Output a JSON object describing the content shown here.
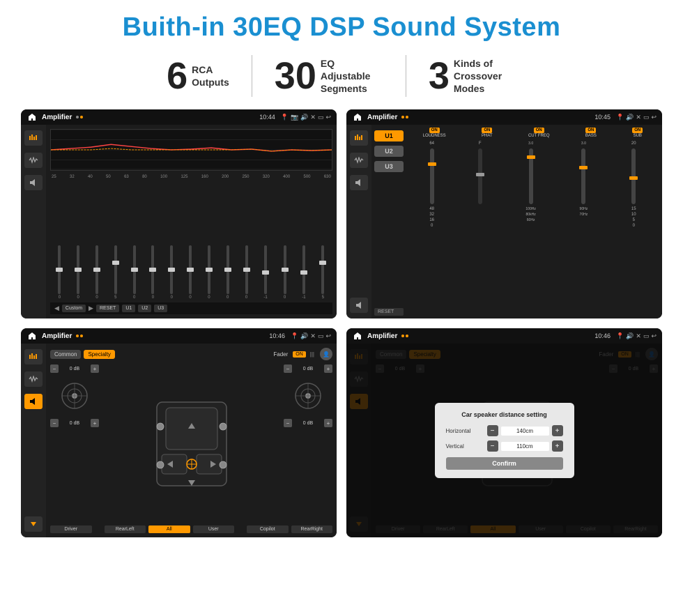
{
  "page": {
    "title": "Buith-in 30EQ DSP Sound System",
    "stats": [
      {
        "number": "6",
        "label": "RCA\nOutputs"
      },
      {
        "number": "30",
        "label": "EQ Adjustable\nSegments"
      },
      {
        "number": "3",
        "label": "Kinds of\nCrossover Modes"
      }
    ],
    "screens": [
      {
        "id": "eq-screen",
        "app": "Amplifier",
        "time": "10:44",
        "type": "eq"
      },
      {
        "id": "crossover-screen",
        "app": "Amplifier",
        "time": "10:45",
        "type": "crossover"
      },
      {
        "id": "fader-screen",
        "app": "Amplifier",
        "time": "10:46",
        "type": "fader"
      },
      {
        "id": "dialog-screen",
        "app": "Amplifier",
        "time": "10:46",
        "type": "dialog"
      }
    ],
    "eq": {
      "frequencies": [
        "25",
        "32",
        "40",
        "50",
        "63",
        "80",
        "100",
        "125",
        "160",
        "200",
        "250",
        "320",
        "400",
        "500",
        "630"
      ],
      "values": [
        "0",
        "0",
        "0",
        "5",
        "0",
        "0",
        "0",
        "0",
        "0",
        "0",
        "0",
        "-1",
        "0",
        "-1"
      ],
      "presets": [
        "Custom",
        "RESET",
        "U1",
        "U2",
        "U3"
      ]
    },
    "crossover": {
      "units": [
        "U1",
        "U2",
        "U3"
      ],
      "columns": [
        "LOUDNESS",
        "PHAT",
        "CUT FREQ",
        "BASS",
        "SUB"
      ]
    },
    "fader": {
      "tabs": [
        "Common",
        "Specialty"
      ],
      "label": "Fader",
      "buttons": [
        "Driver",
        "RearLeft",
        "All",
        "User",
        "Copilot",
        "RearRight"
      ],
      "dbValues": [
        "0 dB",
        "0 dB",
        "0 dB",
        "0 dB"
      ]
    },
    "dialog": {
      "title": "Car speaker distance setting",
      "horizontal_label": "Horizontal",
      "horizontal_value": "140cm",
      "vertical_label": "Vertical",
      "vertical_value": "110cm",
      "confirm_label": "Confirm"
    }
  }
}
